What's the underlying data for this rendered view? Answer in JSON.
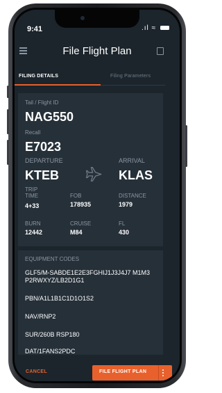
{
  "status": {
    "time": "9:41",
    "signal": ".ıl"
  },
  "header": {
    "title": "File Flight Plan"
  },
  "tabs": [
    {
      "label": "FILING DETAILS",
      "active": true
    },
    {
      "label": "Filing Parameters",
      "active": false
    }
  ],
  "flight": {
    "tail_label": "Tail / Flight ID",
    "tail_value": "NAG550",
    "recall_label": "Recall",
    "recall_value": "E7023",
    "departure_label": "DEPARTURE",
    "departure_value": "KTEB",
    "arrival_label": "ARRIVAL",
    "arrival_value": "KLAS",
    "trip_time_label_1": "TRIP",
    "trip_time_label_2": "TIME",
    "trip_time_value": "4+33",
    "fob_label": "FOB",
    "fob_value": "178935",
    "distance_label": "DISTANCE",
    "distance_value": "1979",
    "burn_label": "BURN",
    "burn_value": "12442",
    "cruise_label": "CRUISE",
    "cruise_value": "M84",
    "fl_label": "FL",
    "fl_value": "430"
  },
  "equipment": {
    "label": "EQUIPMENT CODES",
    "codes": [
      "GLF5/M-SABDE1E2E3FGHIJ1J3J4J7 M1M3 P2RWXYZ/LB2D1G1",
      "PBN/A1L1B1C1D1O1S2",
      "NAV/RNP2",
      "SUR/260B RSP180",
      "DAT/1FANS2PDC"
    ]
  },
  "footer": {
    "cancel_label": "CANCEL",
    "file_label": "FILE FLIGHT PLAN"
  },
  "colors": {
    "accent": "#e8612c",
    "background": "#1c252c",
    "card": "#263039",
    "muted_text": "#8a96a3"
  },
  "icons": [
    "menu-icon",
    "document-icon",
    "airplane-icon",
    "wifi-icon",
    "battery-icon",
    "kebab-icon"
  ]
}
